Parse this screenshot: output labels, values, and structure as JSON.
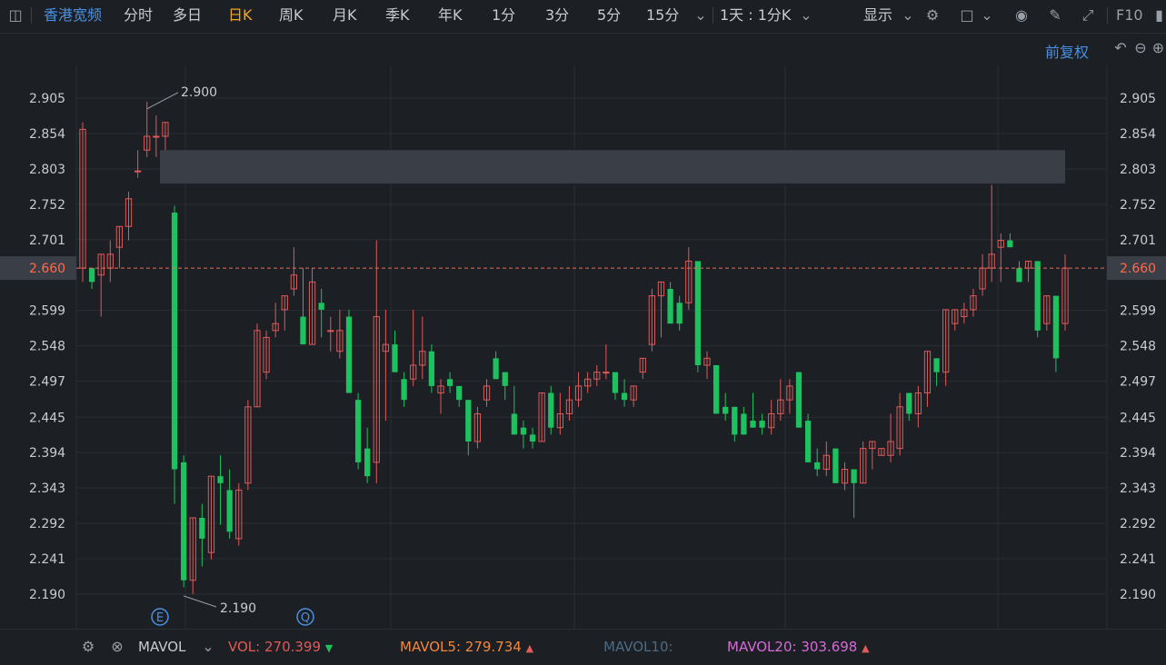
{
  "toolbar": {
    "stock_name": "香港宽频",
    "periods": [
      "分时",
      "多日",
      "日K",
      "周K",
      "月K",
      "季K",
      "年K",
      "1分",
      "3分",
      "5分",
      "15分"
    ],
    "active_period": "日K",
    "interval_select": "1天 : 1分K",
    "display_label": "显示",
    "f10_label": "F10"
  },
  "subbar": {
    "adjust_label": "前复权"
  },
  "colors": {
    "up": "#e05a5a",
    "down": "#1ec15f",
    "grid": "#2a2e35",
    "axis_text": "#c8ccd2",
    "price_line": "#e5705a",
    "price_tag_bg": "#3a3f47",
    "zone": "#3a3f47"
  },
  "chart_data": {
    "type": "candlestick",
    "y_ticks": [
      "2.905",
      "2.854",
      "2.803",
      "2.752",
      "2.701",
      "2.599",
      "2.548",
      "2.497",
      "2.445",
      "2.394",
      "2.343",
      "2.292",
      "2.241",
      "2.190"
    ],
    "ylim": [
      2.14,
      2.96
    ],
    "current_price": "2.660",
    "annotations": {
      "high_label": "2.900",
      "low_label": "2.190"
    },
    "markers": [
      "E",
      "Q"
    ],
    "resistance_zone": [
      2.782,
      2.83
    ],
    "candles": [
      {
        "o": 2.66,
        "h": 2.87,
        "l": 2.64,
        "c": 2.86
      },
      {
        "o": 2.66,
        "h": 2.66,
        "l": 2.63,
        "c": 2.64
      },
      {
        "o": 2.65,
        "h": 2.68,
        "l": 2.59,
        "c": 2.68
      },
      {
        "o": 2.66,
        "h": 2.7,
        "l": 2.64,
        "c": 2.68
      },
      {
        "o": 2.69,
        "h": 2.72,
        "l": 2.66,
        "c": 2.72
      },
      {
        "o": 2.72,
        "h": 2.77,
        "l": 2.7,
        "c": 2.76
      },
      {
        "o": 2.8,
        "h": 2.83,
        "l": 2.79,
        "c": 2.8
      },
      {
        "o": 2.83,
        "h": 2.9,
        "l": 2.82,
        "c": 2.85
      },
      {
        "o": 2.85,
        "h": 2.88,
        "l": 2.82,
        "c": 2.85
      },
      {
        "o": 2.85,
        "h": 2.87,
        "l": 2.83,
        "c": 2.87
      },
      {
        "o": 2.74,
        "h": 2.75,
        "l": 2.32,
        "c": 2.37
      },
      {
        "o": 2.38,
        "h": 2.39,
        "l": 2.2,
        "c": 2.21
      },
      {
        "o": 2.21,
        "h": 2.3,
        "l": 2.19,
        "c": 2.3
      },
      {
        "o": 2.3,
        "h": 2.32,
        "l": 2.23,
        "c": 2.27
      },
      {
        "o": 2.25,
        "h": 2.36,
        "l": 2.24,
        "c": 2.36
      },
      {
        "o": 2.36,
        "h": 2.39,
        "l": 2.29,
        "c": 2.35
      },
      {
        "o": 2.34,
        "h": 2.37,
        "l": 2.27,
        "c": 2.28
      },
      {
        "o": 2.27,
        "h": 2.35,
        "l": 2.26,
        "c": 2.34
      },
      {
        "o": 2.35,
        "h": 2.47,
        "l": 2.34,
        "c": 2.46
      },
      {
        "o": 2.46,
        "h": 2.58,
        "l": 2.46,
        "c": 2.57
      },
      {
        "o": 2.51,
        "h": 2.57,
        "l": 2.5,
        "c": 2.56
      },
      {
        "o": 2.57,
        "h": 2.61,
        "l": 2.56,
        "c": 2.58
      },
      {
        "o": 2.6,
        "h": 2.62,
        "l": 2.57,
        "c": 2.62
      },
      {
        "o": 2.63,
        "h": 2.69,
        "l": 2.62,
        "c": 2.65
      },
      {
        "o": 2.59,
        "h": 2.66,
        "l": 2.55,
        "c": 2.55
      },
      {
        "o": 2.55,
        "h": 2.66,
        "l": 2.55,
        "c": 2.64
      },
      {
        "o": 2.61,
        "h": 2.63,
        "l": 2.56,
        "c": 2.6
      },
      {
        "o": 2.57,
        "h": 2.59,
        "l": 2.54,
        "c": 2.57
      },
      {
        "o": 2.54,
        "h": 2.6,
        "l": 2.53,
        "c": 2.57
      },
      {
        "o": 2.59,
        "h": 2.6,
        "l": 2.48,
        "c": 2.48
      },
      {
        "o": 2.47,
        "h": 2.48,
        "l": 2.37,
        "c": 2.38
      },
      {
        "o": 2.4,
        "h": 2.43,
        "l": 2.35,
        "c": 2.36
      },
      {
        "o": 2.38,
        "h": 2.7,
        "l": 2.35,
        "c": 2.59
      },
      {
        "o": 2.54,
        "h": 2.6,
        "l": 2.44,
        "c": 2.55
      },
      {
        "o": 2.55,
        "h": 2.57,
        "l": 2.51,
        "c": 2.51
      },
      {
        "o": 2.5,
        "h": 2.51,
        "l": 2.46,
        "c": 2.47
      },
      {
        "o": 2.5,
        "h": 2.6,
        "l": 2.49,
        "c": 2.52
      },
      {
        "o": 2.52,
        "h": 2.59,
        "l": 2.5,
        "c": 2.54
      },
      {
        "o": 2.54,
        "h": 2.55,
        "l": 2.48,
        "c": 2.49
      },
      {
        "o": 2.48,
        "h": 2.5,
        "l": 2.45,
        "c": 2.49
      },
      {
        "o": 2.5,
        "h": 2.51,
        "l": 2.48,
        "c": 2.49
      },
      {
        "o": 2.49,
        "h": 2.49,
        "l": 2.46,
        "c": 2.47
      },
      {
        "o": 2.47,
        "h": 2.47,
        "l": 2.39,
        "c": 2.41
      },
      {
        "o": 2.41,
        "h": 2.46,
        "l": 2.4,
        "c": 2.45
      },
      {
        "o": 2.47,
        "h": 2.5,
        "l": 2.46,
        "c": 2.49
      },
      {
        "o": 2.53,
        "h": 2.54,
        "l": 2.5,
        "c": 2.5
      },
      {
        "o": 2.51,
        "h": 2.51,
        "l": 2.47,
        "c": 2.49
      },
      {
        "o": 2.45,
        "h": 2.49,
        "l": 2.43,
        "c": 2.42
      },
      {
        "o": 2.43,
        "h": 2.44,
        "l": 2.4,
        "c": 2.42
      },
      {
        "o": 2.42,
        "h": 2.43,
        "l": 2.4,
        "c": 2.41
      },
      {
        "o": 2.41,
        "h": 2.48,
        "l": 2.41,
        "c": 2.48
      },
      {
        "o": 2.48,
        "h": 2.49,
        "l": 2.42,
        "c": 2.43
      },
      {
        "o": 2.43,
        "h": 2.48,
        "l": 2.42,
        "c": 2.45
      },
      {
        "o": 2.45,
        "h": 2.49,
        "l": 2.44,
        "c": 2.47
      },
      {
        "o": 2.47,
        "h": 2.51,
        "l": 2.46,
        "c": 2.49
      },
      {
        "o": 2.49,
        "h": 2.51,
        "l": 2.48,
        "c": 2.5
      },
      {
        "o": 2.5,
        "h": 2.52,
        "l": 2.49,
        "c": 2.51
      },
      {
        "o": 2.51,
        "h": 2.55,
        "l": 2.5,
        "c": 2.51
      },
      {
        "o": 2.51,
        "h": 2.51,
        "l": 2.47,
        "c": 2.48
      },
      {
        "o": 2.48,
        "h": 2.5,
        "l": 2.46,
        "c": 2.47
      },
      {
        "o": 2.47,
        "h": 2.49,
        "l": 2.46,
        "c": 2.49
      },
      {
        "o": 2.51,
        "h": 2.53,
        "l": 2.5,
        "c": 2.53
      },
      {
        "o": 2.55,
        "h": 2.63,
        "l": 2.54,
        "c": 2.62
      },
      {
        "o": 2.62,
        "h": 2.64,
        "l": 2.56,
        "c": 2.64
      },
      {
        "o": 2.63,
        "h": 2.64,
        "l": 2.58,
        "c": 2.58
      },
      {
        "o": 2.61,
        "h": 2.62,
        "l": 2.57,
        "c": 2.58
      },
      {
        "o": 2.61,
        "h": 2.69,
        "l": 2.6,
        "c": 2.67
      },
      {
        "o": 2.67,
        "h": 2.67,
        "l": 2.51,
        "c": 2.52
      },
      {
        "o": 2.52,
        "h": 2.54,
        "l": 2.5,
        "c": 2.53
      },
      {
        "o": 2.52,
        "h": 2.52,
        "l": 2.45,
        "c": 2.45
      },
      {
        "o": 2.46,
        "h": 2.48,
        "l": 2.44,
        "c": 2.45
      },
      {
        "o": 2.46,
        "h": 2.46,
        "l": 2.41,
        "c": 2.42
      },
      {
        "o": 2.45,
        "h": 2.46,
        "l": 2.42,
        "c": 2.42
      },
      {
        "o": 2.44,
        "h": 2.48,
        "l": 2.43,
        "c": 2.43
      },
      {
        "o": 2.44,
        "h": 2.45,
        "l": 2.42,
        "c": 2.43
      },
      {
        "o": 2.43,
        "h": 2.47,
        "l": 2.42,
        "c": 2.45
      },
      {
        "o": 2.45,
        "h": 2.5,
        "l": 2.44,
        "c": 2.47
      },
      {
        "o": 2.47,
        "h": 2.5,
        "l": 2.45,
        "c": 2.49
      },
      {
        "o": 2.51,
        "h": 2.51,
        "l": 2.43,
        "c": 2.43
      },
      {
        "o": 2.44,
        "h": 2.45,
        "l": 2.38,
        "c": 2.38
      },
      {
        "o": 2.38,
        "h": 2.4,
        "l": 2.36,
        "c": 2.37
      },
      {
        "o": 2.37,
        "h": 2.41,
        "l": 2.36,
        "c": 2.39
      },
      {
        "o": 2.4,
        "h": 2.4,
        "l": 2.35,
        "c": 2.35
      },
      {
        "o": 2.35,
        "h": 2.38,
        "l": 2.34,
        "c": 2.37
      },
      {
        "o": 2.37,
        "h": 2.37,
        "l": 2.3,
        "c": 2.35
      },
      {
        "o": 2.35,
        "h": 2.41,
        "l": 2.35,
        "c": 2.4
      },
      {
        "o": 2.4,
        "h": 2.41,
        "l": 2.37,
        "c": 2.41
      },
      {
        "o": 2.39,
        "h": 2.4,
        "l": 2.39,
        "c": 2.4
      },
      {
        "o": 2.39,
        "h": 2.45,
        "l": 2.38,
        "c": 2.41
      },
      {
        "o": 2.4,
        "h": 2.48,
        "l": 2.39,
        "c": 2.46
      },
      {
        "o": 2.48,
        "h": 2.48,
        "l": 2.44,
        "c": 2.45
      },
      {
        "o": 2.45,
        "h": 2.49,
        "l": 2.43,
        "c": 2.48
      },
      {
        "o": 2.48,
        "h": 2.54,
        "l": 2.46,
        "c": 2.54
      },
      {
        "o": 2.53,
        "h": 2.53,
        "l": 2.49,
        "c": 2.51
      },
      {
        "o": 2.51,
        "h": 2.6,
        "l": 2.49,
        "c": 2.6
      },
      {
        "o": 2.58,
        "h": 2.6,
        "l": 2.57,
        "c": 2.6
      },
      {
        "o": 2.59,
        "h": 2.61,
        "l": 2.58,
        "c": 2.6
      },
      {
        "o": 2.6,
        "h": 2.63,
        "l": 2.59,
        "c": 2.62
      },
      {
        "o": 2.63,
        "h": 2.68,
        "l": 2.62,
        "c": 2.66
      },
      {
        "o": 2.66,
        "h": 2.78,
        "l": 2.64,
        "c": 2.68
      },
      {
        "o": 2.69,
        "h": 2.71,
        "l": 2.64,
        "c": 2.7
      },
      {
        "o": 2.7,
        "h": 2.71,
        "l": 2.69,
        "c": 2.69
      },
      {
        "o": 2.66,
        "h": 2.67,
        "l": 2.64,
        "c": 2.64
      },
      {
        "o": 2.66,
        "h": 2.67,
        "l": 2.64,
        "c": 2.67
      },
      {
        "o": 2.67,
        "h": 2.67,
        "l": 2.56,
        "c": 2.57
      },
      {
        "o": 2.58,
        "h": 2.62,
        "l": 2.57,
        "c": 2.62
      },
      {
        "o": 2.62,
        "h": 2.62,
        "l": 2.51,
        "c": 2.53
      },
      {
        "o": 2.58,
        "h": 2.68,
        "l": 2.57,
        "c": 2.66
      }
    ],
    "volume_indicator": {
      "name": "MAVOL",
      "series": [
        {
          "name": "VOL",
          "value": "270.399",
          "trend": "down",
          "color": "#e05a5a"
        },
        {
          "name": "MAVOL5",
          "value": "279.734",
          "trend": "up",
          "color": "#f0883e"
        },
        {
          "name": "MAVOL10",
          "value": "",
          "trend": "",
          "color": "#4d6a85"
        },
        {
          "name": "MAVOL20",
          "value": "303.698",
          "trend": "up",
          "color": "#d66bd6"
        }
      ]
    }
  }
}
